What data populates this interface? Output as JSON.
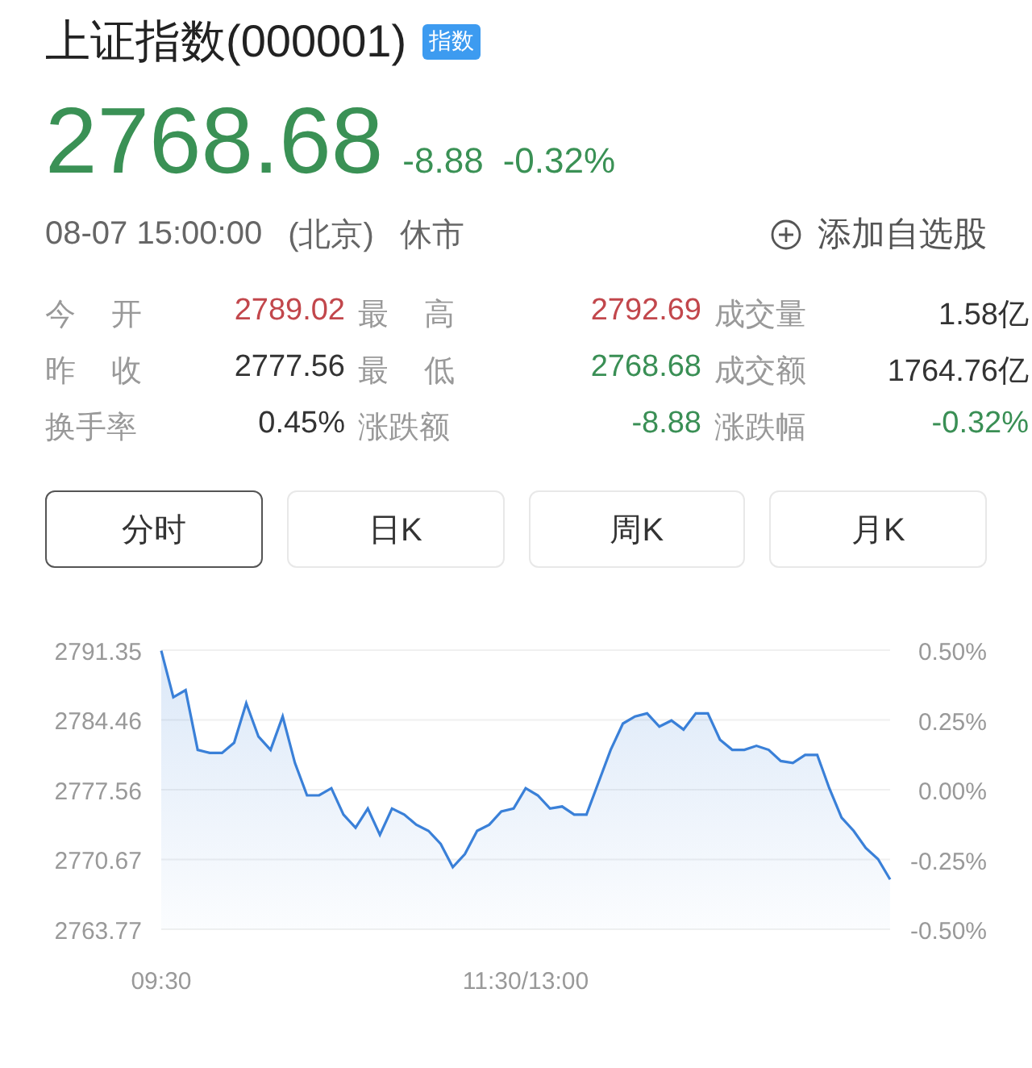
{
  "header": {
    "title": "上证指数(000001)",
    "tag": "指数",
    "price": "2768.68",
    "change": "-8.88",
    "change_percent": "-0.32%",
    "color": "#3a9155",
    "datetime": "08-07 15:00:00",
    "timezone": "(北京)",
    "status": "休市",
    "add_button": "添加自选股"
  },
  "stats": [
    {
      "label": "今开",
      "value": "2789.02",
      "color": "#c2474c"
    },
    {
      "label": "最高",
      "value": "2792.69",
      "color": "#c2474c"
    },
    {
      "label": "成交量",
      "value": "1.58亿",
      "color": "#333333"
    },
    {
      "label": "昨收",
      "value": "2777.56",
      "color": "#333333"
    },
    {
      "label": "最低",
      "value": "2768.68",
      "color": "#3a8f55"
    },
    {
      "label": "成交额",
      "value": "1764.76亿",
      "color": "#333333"
    },
    {
      "label": "换手率",
      "value": "0.45%",
      "color": "#333333"
    },
    {
      "label": "涨跌额",
      "value": "-8.88",
      "color": "#3a8f55"
    },
    {
      "label": "涨跌幅",
      "value": "-0.32%",
      "color": "#3a8f55"
    }
  ],
  "tabs": [
    {
      "label": "分时",
      "selected": true
    },
    {
      "label": "日K",
      "selected": false
    },
    {
      "label": "周K",
      "selected": false
    },
    {
      "label": "月K",
      "selected": false
    }
  ],
  "chart": {
    "chart_data": {
      "type": "area",
      "categories": [
        "09:30",
        null,
        null,
        null,
        null,
        null,
        null,
        null,
        null,
        null,
        null,
        null,
        null,
        null,
        null,
        null,
        null,
        null,
        null,
        null,
        null,
        null,
        null,
        null,
        null,
        null,
        null,
        null,
        null,
        null,
        "11:30/13:00",
        null,
        null,
        null,
        null,
        null,
        null,
        null,
        null,
        null,
        null,
        null,
        null,
        null,
        null,
        null,
        null,
        null,
        null,
        null,
        null,
        null,
        null,
        null,
        null,
        null,
        null,
        null,
        null,
        null,
        null
      ],
      "series": [
        {
          "color": "#3a80d8",
          "values": [
            2791.3,
            2786.7,
            2787.4,
            2781.5,
            2781.2,
            2781.2,
            2782.2,
            2786.1,
            2782.8,
            2781.5,
            2784.8,
            2780.2,
            2777.0,
            2777.0,
            2777.7,
            2775.1,
            2773.8,
            2775.7,
            2773.1,
            2775.7,
            2775.1,
            2774.1,
            2773.5,
            2772.2,
            2769.9,
            2771.2,
            2773.5,
            2774.1,
            2775.4,
            2775.7,
            2777.7,
            2777.0,
            2775.7,
            2775.9,
            2775.1,
            2775.1,
            2778.3,
            2781.5,
            2784.1,
            2784.8,
            2785.1,
            2783.8,
            2784.4,
            2783.5,
            2785.1,
            2785.1,
            2782.5,
            2781.5,
            2781.5,
            2781.9,
            2781.5,
            2780.4,
            2780.2,
            2781.0,
            2781.0,
            2777.7,
            2774.8,
            2773.5,
            2771.8,
            2770.7,
            2768.7
          ]
        }
      ],
      "ylim": [
        2763.77,
        2791.35
      ],
      "grid": true,
      "yticks": [
        {
          "value": 2791.35,
          "label": "2791.35"
        },
        {
          "value": 2784.46,
          "label": "2784.46"
        },
        {
          "value": 2777.56,
          "label": "2777.56"
        },
        {
          "value": 2770.67,
          "label": "2770.67"
        },
        {
          "value": 2763.77,
          "label": "2763.77"
        }
      ],
      "y2ticks": [
        "0.50%",
        "0.25%",
        "0.00%",
        "-0.25%",
        "-0.50%"
      ]
    }
  }
}
